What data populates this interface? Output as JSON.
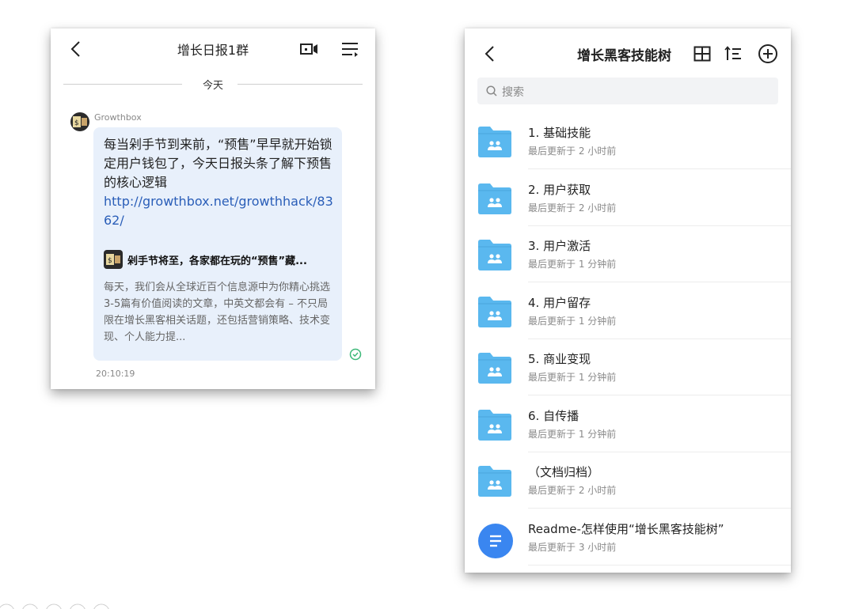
{
  "chat": {
    "title": "增长日报1群",
    "date_separator": "今天",
    "sender": "Growthbox",
    "message_text": "每当剁手节到来前，“预售”早早就开始锁定用户钱包了，今天日报头条了解下预售的核心逻辑",
    "message_link": "http://growthbox.net/growthhack/8362/",
    "card_title": "剁手节将至，各家都在玩的“预售”藏...",
    "card_desc": "每天，我们会从全球近百个信息源中为你精心挑选3-5篇有价值阅读的文章，中英文都会有 – 不只局限在增长黑客相关话题，还包括营销策略、技术变现、个人能力提...",
    "time": "20:10:19",
    "icons": [
      "back-icon",
      "video-call-icon",
      "menu-icon",
      "read-check-icon"
    ]
  },
  "files": {
    "title": "增长黑客技能树",
    "search_placeholder": "搜索",
    "icons": [
      "back-icon",
      "grid-view-icon",
      "sort-icon",
      "add-icon",
      "search-icon",
      "shared-folder-icon",
      "document-icon"
    ],
    "accent_color": "#3a86f0",
    "folder_color": "#5ab8ef",
    "items": [
      {
        "name": "1. 基础技能",
        "updated": "最后更新于 2 小时前",
        "type": "folder"
      },
      {
        "name": "2. 用户获取",
        "updated": "最后更新于 2 小时前",
        "type": "folder"
      },
      {
        "name": "3. 用户激活",
        "updated": "最后更新于 1 分钟前",
        "type": "folder"
      },
      {
        "name": "4. 用户留存",
        "updated": "最后更新于 1 分钟前",
        "type": "folder"
      },
      {
        "name": "5. 商业变现",
        "updated": "最后更新于 1 分钟前",
        "type": "folder"
      },
      {
        "name": "6. 自传播",
        "updated": "最后更新于 1 分钟前",
        "type": "folder"
      },
      {
        "name": "（文档归档）",
        "updated": "最后更新于 2 小时前",
        "type": "folder"
      },
      {
        "name": "Readme-怎样使用“增长黑客技能树”",
        "updated": "最后更新于 3 小时前",
        "type": "doc"
      }
    ]
  }
}
